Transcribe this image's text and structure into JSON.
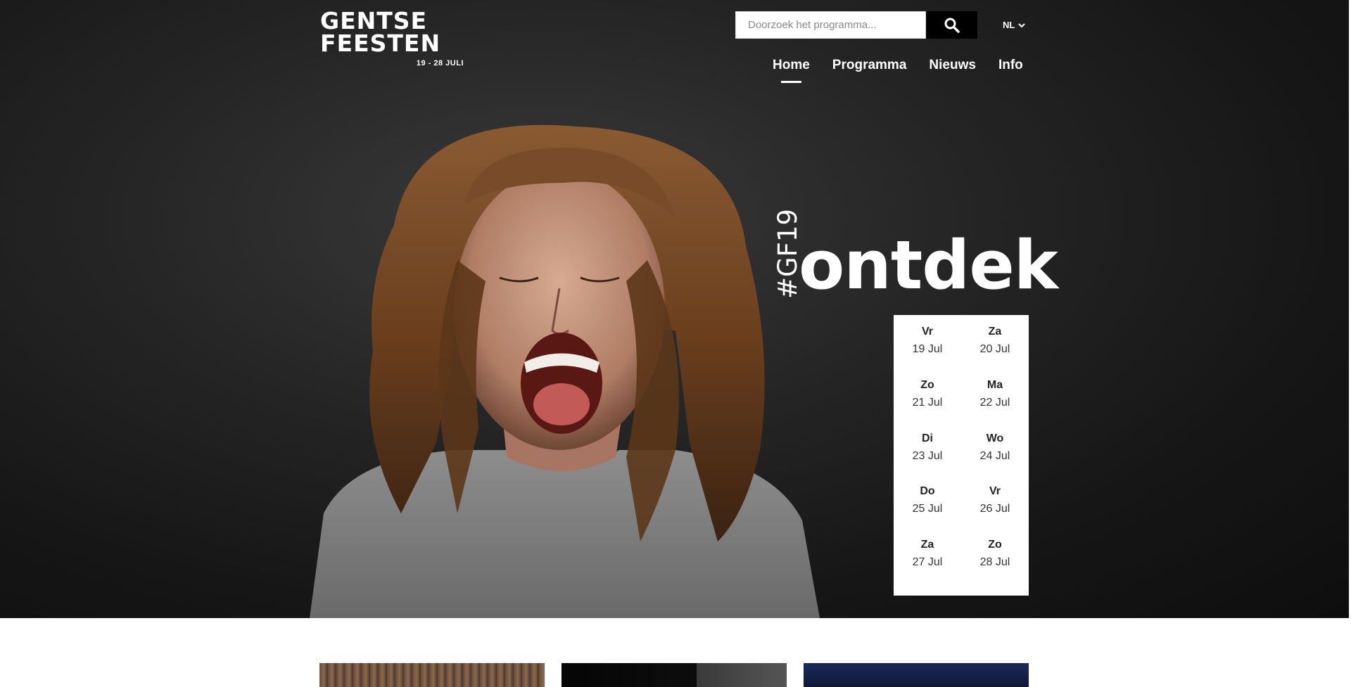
{
  "header": {
    "logo": {
      "line1": "GENTSE",
      "line2": "FEESTEN",
      "dates": "19 - 28 JULI"
    },
    "search": {
      "placeholder": "Doorzoek het programma..."
    },
    "language": "NL"
  },
  "nav": {
    "items": [
      {
        "label": "Home",
        "active": true
      },
      {
        "label": "Programma",
        "active": false
      },
      {
        "label": "Nieuws",
        "active": false
      },
      {
        "label": "Info",
        "active": false
      }
    ]
  },
  "hero": {
    "hashtag": "#GF19",
    "headline": "ontdek",
    "dates": [
      {
        "day": "Vr",
        "date": "19 Jul"
      },
      {
        "day": "Za",
        "date": "20 Jul"
      },
      {
        "day": "Zo",
        "date": "21 Jul"
      },
      {
        "day": "Ma",
        "date": "22 Jul"
      },
      {
        "day": "Di",
        "date": "23 Jul"
      },
      {
        "day": "Wo",
        "date": "24 Jul"
      },
      {
        "day": "Do",
        "date": "25 Jul"
      },
      {
        "day": "Vr",
        "date": "26 Jul"
      },
      {
        "day": "Za",
        "date": "27 Jul"
      },
      {
        "day": "Zo",
        "date": "28 Jul"
      }
    ]
  },
  "colors": {
    "hero_background": "#1c1c1c",
    "accent": "#ffffff",
    "search_button": "#000000"
  }
}
